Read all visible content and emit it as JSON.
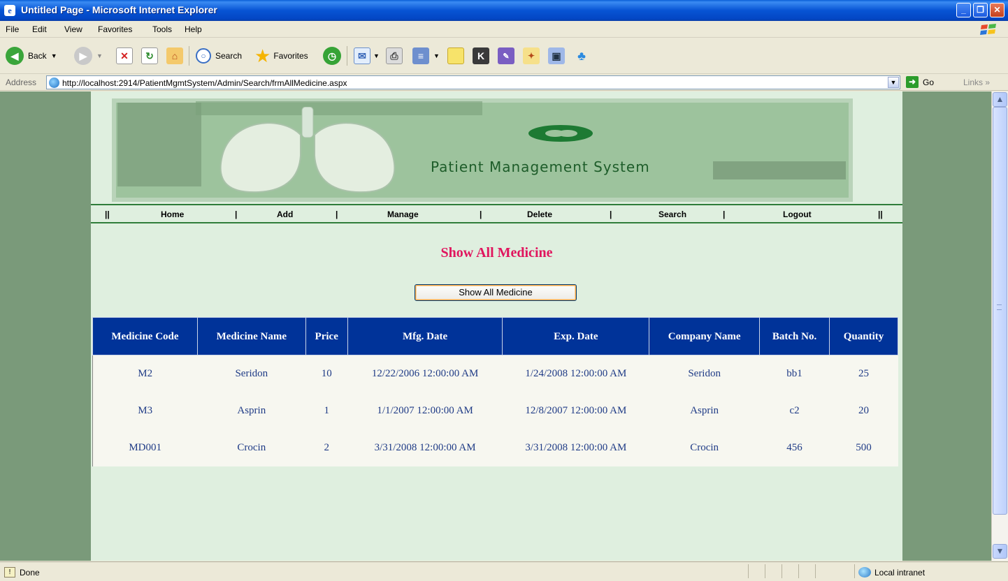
{
  "window": {
    "title": "Untitled Page - Microsoft Internet Explorer",
    "controls": {
      "minimize": "_",
      "maximize": "❐",
      "close": "✕"
    }
  },
  "menu": [
    "File",
    "Edit",
    "View",
    "Favorites",
    "Tools",
    "Help"
  ],
  "toolbar": {
    "back_label": "Back",
    "search_label": "Search",
    "favorites_label": "Favorites"
  },
  "address": {
    "label": "Address",
    "url": "http://localhost:2914/PatientMgmtSystem/Admin/Search/frmAllMedicine.aspx",
    "go_label": "Go",
    "links_label": "Links"
  },
  "site": {
    "brand": "Patient Management System",
    "nav": {
      "items": [
        "Home",
        "Add",
        "Manage",
        "Delete",
        "Search",
        "Logout"
      ],
      "separators": [
        "||",
        "|",
        "|",
        "|",
        "|",
        "|",
        "||"
      ]
    },
    "heading": "Show All Medicine",
    "show_button_label": "Show All Medicine"
  },
  "grid": {
    "headers": [
      "Medicine Code",
      "Medicine Name",
      "Price",
      "Mfg. Date",
      "Exp. Date",
      "Company Name",
      "Batch No.",
      "Quantity"
    ],
    "rows": [
      [
        "M2",
        "Seridon",
        "10",
        "12/22/2006 12:00:00 AM",
        "1/24/2008 12:00:00 AM",
        "Seridon",
        "bb1",
        "25"
      ],
      [
        "M3",
        "Asprin",
        "1",
        "1/1/2007 12:00:00 AM",
        "12/8/2007 12:00:00 AM",
        "Asprin",
        "c2",
        "20"
      ],
      [
        "MD001",
        "Crocin",
        "2",
        "3/31/2008 12:00:00 AM",
        "3/31/2008 12:00:00 AM",
        "Crocin",
        "456",
        "500"
      ]
    ]
  },
  "status": {
    "text": "Done",
    "zone": "Local intranet"
  },
  "colors": {
    "title_bar": "#0754d4",
    "page_bg": "#dfefdf",
    "outer_bg": "#7a9a7a",
    "heading": "#e0165e",
    "grid_header": "#003399",
    "grid_text": "#1f3b86",
    "nav_rule": "#2f7d3a"
  },
  "icons": [
    "ie-icon",
    "back-icon",
    "forward-icon",
    "stop-icon",
    "refresh-icon",
    "home-icon",
    "search-icon",
    "favorites-icon",
    "history-icon",
    "mail-icon",
    "print-icon",
    "edit-icon",
    "discuss-icon",
    "messenger-icon",
    "page-icon",
    "go-icon",
    "done-icon",
    "intranet-icon"
  ]
}
